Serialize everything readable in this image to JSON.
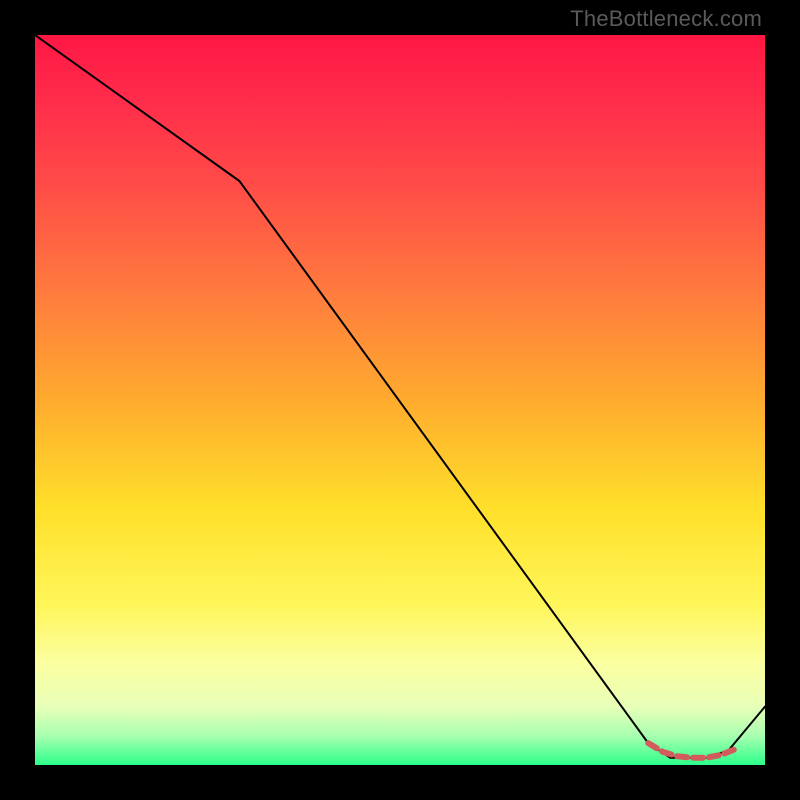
{
  "watermark": "TheBottleneck.com",
  "chart_data": {
    "type": "line",
    "title": "",
    "xlabel": "",
    "ylabel": "",
    "xlim": [
      0,
      100
    ],
    "ylim": [
      0,
      100
    ],
    "grid": false,
    "series": [
      {
        "name": "curve",
        "color": "#000000",
        "stroke_width": 2,
        "x": [
          0,
          28,
          84,
          87,
          92,
          95,
          100
        ],
        "y": [
          100,
          80,
          3,
          1,
          1,
          2,
          8
        ]
      },
      {
        "name": "highlight",
        "color": "#d45b5b",
        "stroke_width": 6,
        "dash": "10 6",
        "x": [
          84,
          86,
          88,
          90,
          92,
          94,
          96
        ],
        "y": [
          3,
          1.8,
          1.2,
          1.0,
          1.0,
          1.4,
          2.2
        ]
      }
    ],
    "background_gradient": {
      "stops": [
        {
          "offset": 0.0,
          "color": "#ff1744"
        },
        {
          "offset": 0.08,
          "color": "#ff2a4a"
        },
        {
          "offset": 0.2,
          "color": "#ff4a48"
        },
        {
          "offset": 0.35,
          "color": "#ff7a3e"
        },
        {
          "offset": 0.5,
          "color": "#ffab2e"
        },
        {
          "offset": 0.65,
          "color": "#ffe02a"
        },
        {
          "offset": 0.78,
          "color": "#fff65a"
        },
        {
          "offset": 0.86,
          "color": "#fbffa0"
        },
        {
          "offset": 0.92,
          "color": "#e8ffb8"
        },
        {
          "offset": 0.96,
          "color": "#a8ffb0"
        },
        {
          "offset": 1.0,
          "color": "#2cff8a"
        }
      ]
    }
  }
}
